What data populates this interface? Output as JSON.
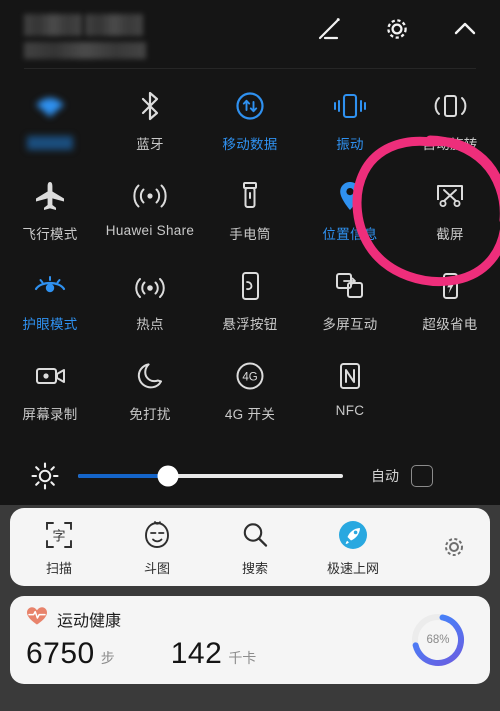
{
  "meta": {
    "accent_blue": "#2f91f0",
    "annotation_pink": "#ee2e7b",
    "panel_bg": "#151515",
    "page_bg": "#3a3a3a"
  },
  "header": {
    "user_line1": "",
    "user_line2": "",
    "icons": [
      {
        "name": "edit-icon",
        "label": "编辑"
      },
      {
        "name": "settings-gear-icon",
        "label": "设置"
      },
      {
        "name": "collapse-chevron-up-icon",
        "label": "收起"
      }
    ]
  },
  "quick_settings": {
    "rows": [
      [
        {
          "label": "WLAN",
          "icon": "wlan-icon",
          "active": true,
          "redacted": true
        },
        {
          "label": "蓝牙",
          "icon": "bluetooth-icon",
          "active": false
        },
        {
          "label": "移动数据",
          "icon": "mobile-data-icon",
          "active": true
        },
        {
          "label": "振动",
          "icon": "vibrate-icon",
          "active": true
        },
        {
          "label": "自动旋转",
          "icon": "auto-rotate-icon",
          "active": false
        }
      ],
      [
        {
          "label": "飞行模式",
          "icon": "airplane-mode-icon",
          "active": false
        },
        {
          "label": "Huawei Share",
          "icon": "huawei-share-icon",
          "active": false
        },
        {
          "label": "手电筒",
          "icon": "flashlight-icon",
          "active": false
        },
        {
          "label": "位置信息",
          "icon": "location-pin-icon",
          "active": true
        },
        {
          "label": "截屏",
          "icon": "screenshot-scissors-icon",
          "active": false,
          "annotated": true
        }
      ],
      [
        {
          "label": "护眼模式",
          "icon": "eye-comfort-icon",
          "active": true
        },
        {
          "label": "热点",
          "icon": "hotspot-icon",
          "active": false
        },
        {
          "label": "悬浮按钮",
          "icon": "floating-button-icon",
          "active": false
        },
        {
          "label": "多屏互动",
          "icon": "multi-screen-icon",
          "active": false
        },
        {
          "label": "超级省电",
          "icon": "ultra-power-saving-icon",
          "active": false
        }
      ],
      [
        {
          "label": "屏幕录制",
          "icon": "screen-record-icon",
          "active": false
        },
        {
          "label": "免打扰",
          "icon": "do-not-disturb-moon-icon",
          "active": false
        },
        {
          "label": "4G 开关",
          "icon": "four-g-toggle-icon",
          "active": false
        },
        {
          "label": "NFC",
          "icon": "nfc-icon",
          "active": false
        },
        {
          "label": "",
          "icon": "",
          "empty": true
        }
      ]
    ]
  },
  "brightness": {
    "icon": "brightness-sun-icon",
    "value_percent": 34,
    "auto_label": "自动",
    "auto_checked": false
  },
  "shortcuts": {
    "items": [
      {
        "label": "扫描",
        "icon": "scan-text-icon"
      },
      {
        "label": "斗图",
        "icon": "meme-face-icon"
      },
      {
        "label": "搜索",
        "icon": "search-magnifier-icon"
      },
      {
        "label": "极速上网",
        "icon": "fast-internet-rocket-icon"
      }
    ],
    "settings_icon": "shortcuts-gear-icon"
  },
  "health": {
    "icon": "heartbeat-icon",
    "title": "运动健康",
    "steps_value": "6750",
    "steps_unit": "步",
    "calories_value": "142",
    "calories_unit": "千卡",
    "ring_percent": "68%",
    "ring_value": 68
  }
}
